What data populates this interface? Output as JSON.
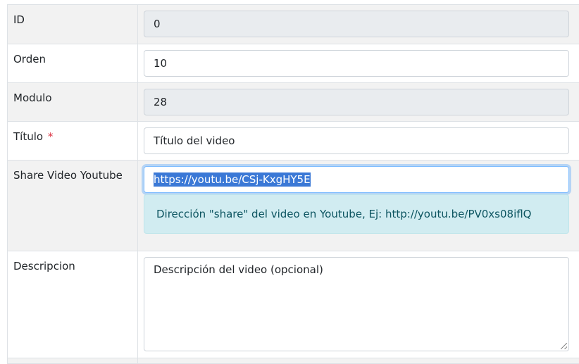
{
  "form": {
    "id": {
      "label": "ID",
      "value": "0"
    },
    "orden": {
      "label": "Orden",
      "value": "10"
    },
    "modulo": {
      "label": "Modulo",
      "value": "28"
    },
    "titulo": {
      "label": "Título",
      "required_mark": "*",
      "value": "Título del video"
    },
    "share": {
      "label": "Share Video Youtube",
      "value": "https://youtu.be/CSj-KxgHY5E",
      "help": "Dirección \"share\" del video en Youtube, Ej: http://youtu.be/PV0xs08iflQ"
    },
    "descripcion": {
      "label": "Descripcion",
      "placeholder": "Descripción del video (opcional)"
    }
  }
}
